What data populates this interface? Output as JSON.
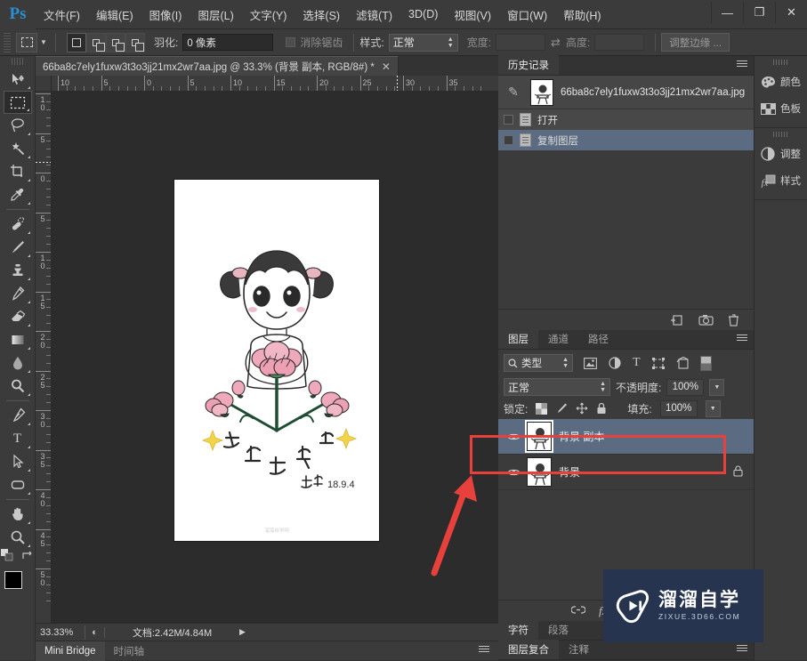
{
  "app": {
    "logo": "Ps",
    "menus": [
      "文件(F)",
      "编辑(E)",
      "图像(I)",
      "图层(L)",
      "文字(Y)",
      "选择(S)",
      "滤镜(T)",
      "3D(D)",
      "视图(V)",
      "窗口(W)",
      "帮助(H)"
    ],
    "window_controls": {
      "minimize": "—",
      "maximize": "❐",
      "close": "✕"
    }
  },
  "options_bar": {
    "tool_icon": "rectangular-marquee",
    "modes": [
      "new-selection",
      "add-to-selection",
      "subtract-from-selection",
      "intersect-selection"
    ],
    "feather_label": "羽化:",
    "feather_value": "0 像素",
    "antialias_label": "消除锯齿",
    "style_label": "样式:",
    "style_value": "正常",
    "width_label": "宽度:",
    "width_value": "",
    "swap_icon": "swap-arrows",
    "height_label": "高度:",
    "height_value": "",
    "refine_edge_label": "调整边缘 ..."
  },
  "document": {
    "tab_title": "66ba8c7ely1fuxw3t3o3jj21mx2wr7aa.jpg @ 33.3% (背景 副本, RGB/8#) *",
    "tab_close": "✕",
    "h_ruler_ticks": [
      "10",
      "5",
      "0",
      "5",
      "10",
      "15",
      "20",
      "25",
      "30",
      "35"
    ],
    "v_ruler_ticks": [
      "10",
      "5",
      "0",
      "5",
      "10",
      "15",
      "20",
      "25",
      "30",
      "35",
      "40",
      "45",
      "50"
    ],
    "artwork_watermark": "溜溜自学网"
  },
  "status_bar": {
    "zoom": "33.33%",
    "doc_icon": "doc-size-icon",
    "doc_info": "文档:2.42M/4.84M",
    "arrow": "▶"
  },
  "bottom_tabs": [
    {
      "label": "Mini Bridge",
      "active": true
    },
    {
      "label": "时间轴",
      "active": false
    }
  ],
  "toolbar": {
    "tools": [
      {
        "name": "move-tool",
        "active": false
      },
      {
        "name": "rectangular-marquee-tool",
        "active": true
      },
      {
        "name": "lasso-tool",
        "active": false
      },
      {
        "name": "magic-wand-tool",
        "active": false
      },
      {
        "name": "crop-tool",
        "active": false
      },
      {
        "name": "eyedropper-tool",
        "active": false
      },
      {
        "name": "healing-brush-tool",
        "active": false
      },
      {
        "name": "brush-tool",
        "active": false
      },
      {
        "name": "clone-stamp-tool",
        "active": false
      },
      {
        "name": "history-brush-tool",
        "active": false
      },
      {
        "name": "eraser-tool",
        "active": false
      },
      {
        "name": "gradient-tool",
        "active": false
      },
      {
        "name": "blur-tool",
        "active": false
      },
      {
        "name": "dodge-tool",
        "active": false
      },
      {
        "name": "pen-tool",
        "active": false
      },
      {
        "name": "type-tool",
        "active": false
      },
      {
        "name": "path-selection-tool",
        "active": false
      },
      {
        "name": "shape-tool",
        "active": false
      },
      {
        "name": "hand-tool",
        "active": false
      },
      {
        "name": "zoom-tool",
        "active": false
      }
    ],
    "type_tool_glyph": "T",
    "foreground_color": "#000000",
    "background_color": "#ffffff"
  },
  "history_panel": {
    "tabs": [
      {
        "label": "历史记录",
        "active": true
      }
    ],
    "snapshot": {
      "label": "66ba8c7ely1fuxw3t3o3jj21mx2wr7aa.jpg"
    },
    "states": [
      {
        "label": "打开",
        "selected": false
      },
      {
        "label": "复制图层",
        "selected": true
      }
    ],
    "footer_icons": [
      "new-document-icon",
      "new-snapshot-icon",
      "delete-icon"
    ]
  },
  "layers_panel": {
    "tabs": [
      {
        "label": "图层",
        "active": true
      },
      {
        "label": "通道",
        "active": false
      },
      {
        "label": "路径",
        "active": false
      }
    ],
    "filter_type_label": "类型",
    "filter_icons": [
      "pixel-filter-icon",
      "adjustment-filter-icon",
      "type-filter-icon",
      "shape-filter-icon",
      "smart-object-filter-icon"
    ],
    "blend_mode": "正常",
    "opacity_label": "不透明度:",
    "opacity_value": "100%",
    "lock_label": "锁定:",
    "lock_icons": [
      "lock-transparent-icon",
      "lock-image-icon",
      "lock-position-icon",
      "lock-all-icon"
    ],
    "fill_label": "填充:",
    "fill_value": "100%",
    "layers": [
      {
        "name": "背景 副本",
        "visible": true,
        "selected": true,
        "locked": false
      },
      {
        "name": "背景",
        "visible": true,
        "selected": false,
        "locked": true
      }
    ],
    "footer_icons": [
      "link-layers-icon",
      "layer-style-fx-icon",
      "layer-mask-icon"
    ],
    "fx_label": "fx."
  },
  "bottom_panel_tabs": [
    [
      {
        "label": "字符",
        "active": true
      },
      {
        "label": "段落",
        "active": false
      }
    ],
    [
      {
        "label": "图层复合",
        "active": true
      },
      {
        "label": "注释",
        "active": false
      }
    ]
  ],
  "icon_dock": {
    "groups": [
      [
        {
          "label": "颜色",
          "icon": "color-palette-icon"
        },
        {
          "label": "色板",
          "icon": "swatches-icon"
        }
      ],
      [
        {
          "label": "调整",
          "icon": "adjustments-icon"
        },
        {
          "label": "样式",
          "icon": "styles-fx-icon"
        }
      ]
    ]
  },
  "annotation": {
    "highlight_color": "#e8413c",
    "arrow": "red-arrow-pointing-to-layer"
  },
  "watermark": {
    "cn_text": "溜溜自学",
    "en_text": "ZIXUE.3D66.COM",
    "bg_color": "#27344f"
  }
}
